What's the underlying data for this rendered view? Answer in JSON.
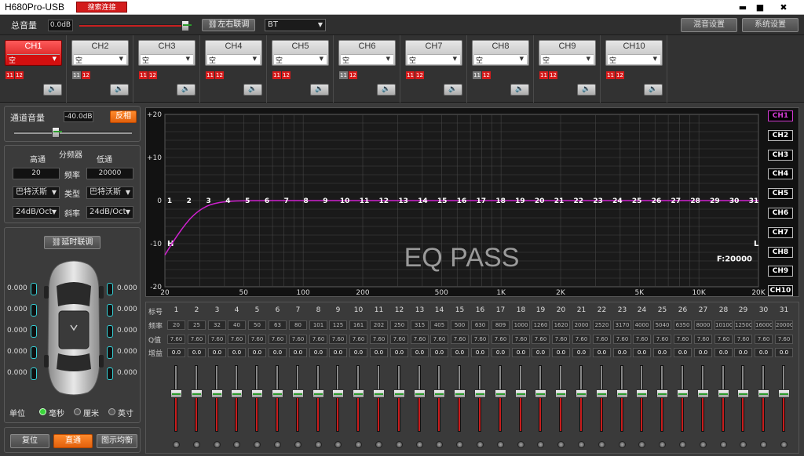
{
  "app": {
    "title": "H680Pro-USB",
    "search_button": "搜索连接",
    "win_min": "▬",
    "win_max": "■",
    "win_close": "✖"
  },
  "toolbar": {
    "master_label": "总音量",
    "master_value": "0.0dB",
    "master_level": 1.0,
    "link_button": "左右联调",
    "link_icon": "link-icon",
    "source": "BT",
    "mix_button": "混音设置",
    "sys_button": "系统设置"
  },
  "channels": [
    {
      "name": "CH1",
      "source": "空",
      "active": true
    },
    {
      "name": "CH2",
      "source": "空",
      "active": false
    },
    {
      "name": "CH3",
      "source": "空",
      "active": false
    },
    {
      "name": "CH4",
      "source": "空",
      "active": false
    },
    {
      "name": "CH5",
      "source": "空",
      "active": false
    },
    {
      "name": "CH6",
      "source": "空",
      "active": false
    },
    {
      "name": "CH7",
      "source": "空",
      "active": false
    },
    {
      "name": "CH8",
      "source": "空",
      "active": false
    },
    {
      "name": "CH9",
      "source": "空",
      "active": false
    },
    {
      "name": "CH10",
      "source": "空",
      "active": false
    }
  ],
  "channel_tags": [
    "11",
    "12"
  ],
  "channel_volume": {
    "label": "通道音量",
    "value": "-40.0dB",
    "invert_button": "反相",
    "level": 0.33
  },
  "crossover": {
    "title": "分频器",
    "high_label": "高通",
    "low_label": "低通",
    "freq_label": "频率",
    "high_freq": "20",
    "low_freq": "20000",
    "type_label": "类型",
    "high_type": "巴特沃斯",
    "low_type": "巴特沃斯",
    "slope_label": "斜率",
    "high_slope": "24dB/Oct",
    "low_slope": "24dB/Oct"
  },
  "delay": {
    "link_button": "延时联调",
    "left_values": [
      "0.000",
      "0.000",
      "0.000",
      "0.000",
      "0.000"
    ],
    "right_values": [
      "0.000",
      "0.000",
      "0.000",
      "0.000",
      "0.000"
    ],
    "unit_label": "单位",
    "units": [
      {
        "label": "毫秒",
        "selected": true
      },
      {
        "label": "厘米",
        "selected": false
      },
      {
        "label": "英寸",
        "selected": false
      }
    ]
  },
  "bottom_buttons": {
    "reset": "复位",
    "direct": "直通",
    "graph_eq": "图示均衡"
  },
  "graph": {
    "y_ticks": [
      "+20",
      "+10",
      "0",
      "-10",
      "-20"
    ],
    "x_ticks": [
      "20",
      "50",
      "100",
      "200",
      "500",
      "1K",
      "2K",
      "5K",
      "10K",
      "20K"
    ],
    "band_markers": [
      "1",
      "2",
      "3",
      "4",
      "5",
      "6",
      "7",
      "8",
      "9",
      "10",
      "11",
      "12",
      "13",
      "14",
      "15",
      "16",
      "17",
      "18",
      "19",
      "20",
      "21",
      "22",
      "23",
      "24",
      "25",
      "26",
      "27",
      "28",
      "29",
      "30",
      "31"
    ],
    "watermark": "EQ PASS",
    "h_marker": "H",
    "l_marker": "L",
    "freq_readout": "F:20000",
    "curve_color": "#d021d0",
    "legend": [
      "CH1",
      "CH2",
      "CH3",
      "CH4",
      "CH5",
      "CH6",
      "CH7",
      "CH8",
      "CH9",
      "CH10"
    ]
  },
  "eq": {
    "row_labels": {
      "band": "标号",
      "freq": "频率",
      "q": "Q值",
      "gain": "增益"
    },
    "bands": [
      "1",
      "2",
      "3",
      "4",
      "5",
      "6",
      "7",
      "8",
      "9",
      "10",
      "11",
      "12",
      "13",
      "14",
      "15",
      "16",
      "17",
      "18",
      "19",
      "20",
      "21",
      "22",
      "23",
      "24",
      "25",
      "26",
      "27",
      "28",
      "29",
      "30",
      "31"
    ],
    "freqs": [
      "20",
      "25",
      "32",
      "40",
      "50",
      "63",
      "80",
      "101",
      "125",
      "161",
      "202",
      "250",
      "315",
      "405",
      "500",
      "630",
      "809",
      "1000",
      "1260",
      "1620",
      "2000",
      "2520",
      "3170",
      "4000",
      "5040",
      "6350",
      "8000",
      "10100",
      "12500",
      "16000",
      "20000"
    ],
    "q": [
      "7.60",
      "7.60",
      "7.60",
      "7.60",
      "7.60",
      "7.60",
      "7.60",
      "7.60",
      "7.60",
      "7.60",
      "7.60",
      "7.60",
      "7.60",
      "7.60",
      "7.60",
      "7.60",
      "7.60",
      "7.60",
      "7.60",
      "7.60",
      "7.60",
      "7.60",
      "7.60",
      "7.60",
      "7.60",
      "7.60",
      "7.60",
      "7.60",
      "7.60",
      "7.60",
      "7.60"
    ],
    "gain": [
      "0.0",
      "0.0",
      "0.0",
      "0.0",
      "0.0",
      "0.0",
      "0.0",
      "0.0",
      "0.0",
      "0.0",
      "0.0",
      "0.0",
      "0.0",
      "0.0",
      "0.0",
      "0.0",
      "0.0",
      "0.0",
      "0.0",
      "0.0",
      "0.0",
      "0.0",
      "0.0",
      "0.0",
      "0.0",
      "0.0",
      "0.0",
      "0.0",
      "0.0",
      "0.0",
      "0.0"
    ],
    "slider_level": 0.5
  },
  "colors": {
    "accent_red": "#d61b1b",
    "accent_orange": "#f07418",
    "active_green": "#3ad43a",
    "speaker_cyan": "#35d0d6"
  }
}
